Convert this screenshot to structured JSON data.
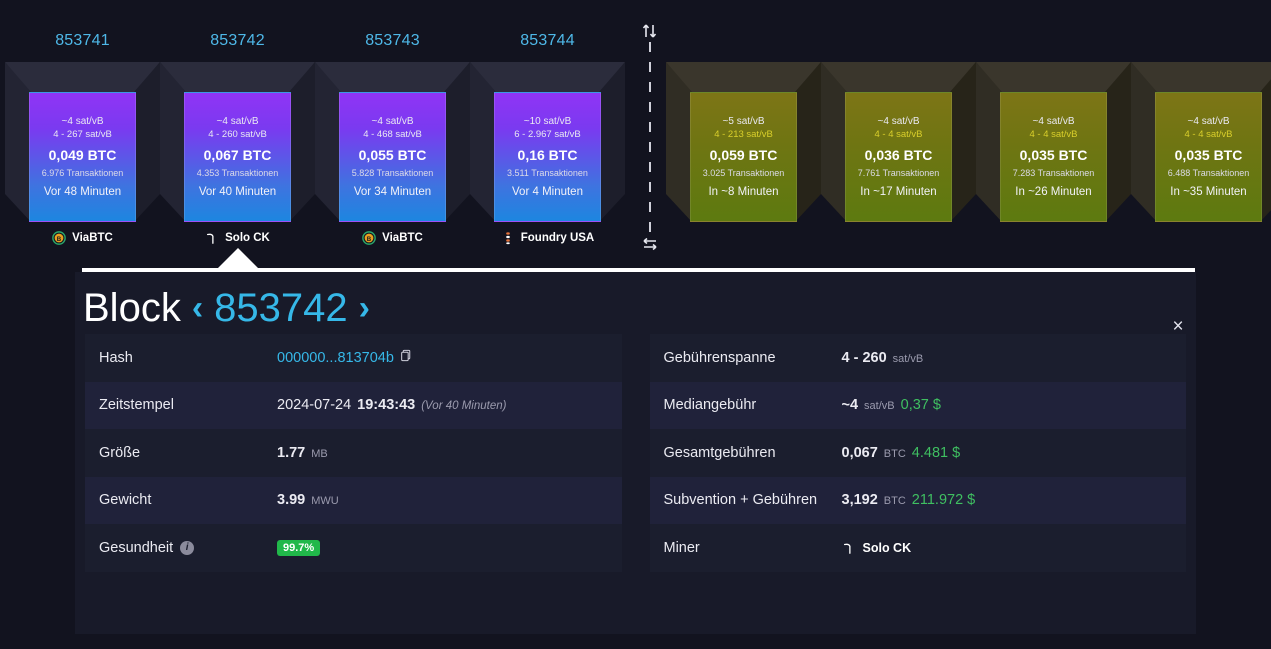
{
  "chain": {
    "confirmed_blocks": [
      {
        "height": "853741",
        "median_fee": "~4 sat/vB",
        "fee_range": "4 - 267 sat/vB",
        "reward": "0,049 BTC",
        "tx_count": "6.976 Transaktionen",
        "time": "Vor 48 Minuten",
        "pool": "ViaBTC",
        "pool_icon": "viabtc-icon"
      },
      {
        "height": "853742",
        "median_fee": "~4 sat/vB",
        "fee_range": "4 - 260 sat/vB",
        "reward": "0,067 BTC",
        "tx_count": "4.353 Transaktionen",
        "time": "Vor 40 Minuten",
        "pool": "Solo CK",
        "pool_icon": "solock-icon"
      },
      {
        "height": "853743",
        "median_fee": "~4 sat/vB",
        "fee_range": "4 - 468 sat/vB",
        "reward": "0,055 BTC",
        "tx_count": "5.828 Transaktionen",
        "time": "Vor 34 Minuten",
        "pool": "ViaBTC",
        "pool_icon": "viabtc-icon"
      },
      {
        "height": "853744",
        "median_fee": "~10 sat/vB",
        "fee_range": "6 - 2.967 sat/vB",
        "reward": "0,16 BTC",
        "tx_count": "3.511 Transaktionen",
        "time": "Vor 4 Minuten",
        "pool": "Foundry USA",
        "pool_icon": "foundry-icon"
      }
    ],
    "mempool_blocks": [
      {
        "median_fee": "~5 sat/vB",
        "fee_range": "4 - 213 sat/vB",
        "reward": "0,059 BTC",
        "tx_count": "3.025 Transaktionen",
        "time": "In ~8 Minuten"
      },
      {
        "median_fee": "~4 sat/vB",
        "fee_range": "4 - 4 sat/vB",
        "reward": "0,036 BTC",
        "tx_count": "7.761 Transaktionen",
        "time": "In ~17 Minuten"
      },
      {
        "median_fee": "~4 sat/vB",
        "fee_range": "4 - 4 sat/vB",
        "reward": "0,035 BTC",
        "tx_count": "7.283 Transaktionen",
        "time": "In ~26 Minuten"
      },
      {
        "median_fee": "~4 sat/vB",
        "fee_range": "4 - 4 sat/vB",
        "reward": "0,035 BTC",
        "tx_count": "6.488 Transaktionen",
        "time": "In ~35 Minuten"
      }
    ],
    "selected_index": 1,
    "divider": {
      "top_icon": "sort-vertical-icon",
      "bottom_icon": "swap-horizontal-icon"
    }
  },
  "details": {
    "title_word": "Block",
    "prev_chevron": "‹",
    "next_chevron": "›",
    "height": "853742",
    "close_icon": "×",
    "left_rows": [
      {
        "key": "Hash",
        "value": "000000...813704b",
        "kind": "hash"
      },
      {
        "key": "Zeitstempel",
        "value_date": "2024-07-24",
        "value_time": "19:43:43",
        "value_rel": "(Vor 40 Minuten)",
        "kind": "timestamp"
      },
      {
        "key": "Größe",
        "value": "1.77",
        "unit": "MB",
        "kind": "measure"
      },
      {
        "key": "Gewicht",
        "value": "3.99",
        "unit": "MWU",
        "kind": "measure"
      },
      {
        "key": "Gesundheit",
        "value": "99.7%",
        "kind": "health"
      }
    ],
    "right_rows": [
      {
        "key": "Gebührenspanne",
        "value": "4 - 260",
        "unit": "sat/vB",
        "kind": "measure"
      },
      {
        "key": "Mediangebühr",
        "value": "~4",
        "unit": "sat/vB",
        "usd": "0,37 $",
        "kind": "measure-usd"
      },
      {
        "key": "Gesamtgebühren",
        "value": "0,067",
        "unit": "BTC",
        "usd": "4.481 $",
        "kind": "measure-usd"
      },
      {
        "key": "Subvention + Gebühren",
        "value": "3,192",
        "unit": "BTC",
        "usd": "211.972 $",
        "kind": "measure-usd"
      },
      {
        "key": "Miner",
        "value": "Solo CK",
        "icon": "solock-icon",
        "kind": "miner"
      }
    ]
  },
  "colors": {
    "page_bg": "#12131f",
    "panel_bg": "#181a29",
    "accent_blue": "#36b8e8",
    "usd_green": "#3fbf61",
    "health_green": "#21b84a",
    "mempool_yellow": "#d9cf2b"
  }
}
